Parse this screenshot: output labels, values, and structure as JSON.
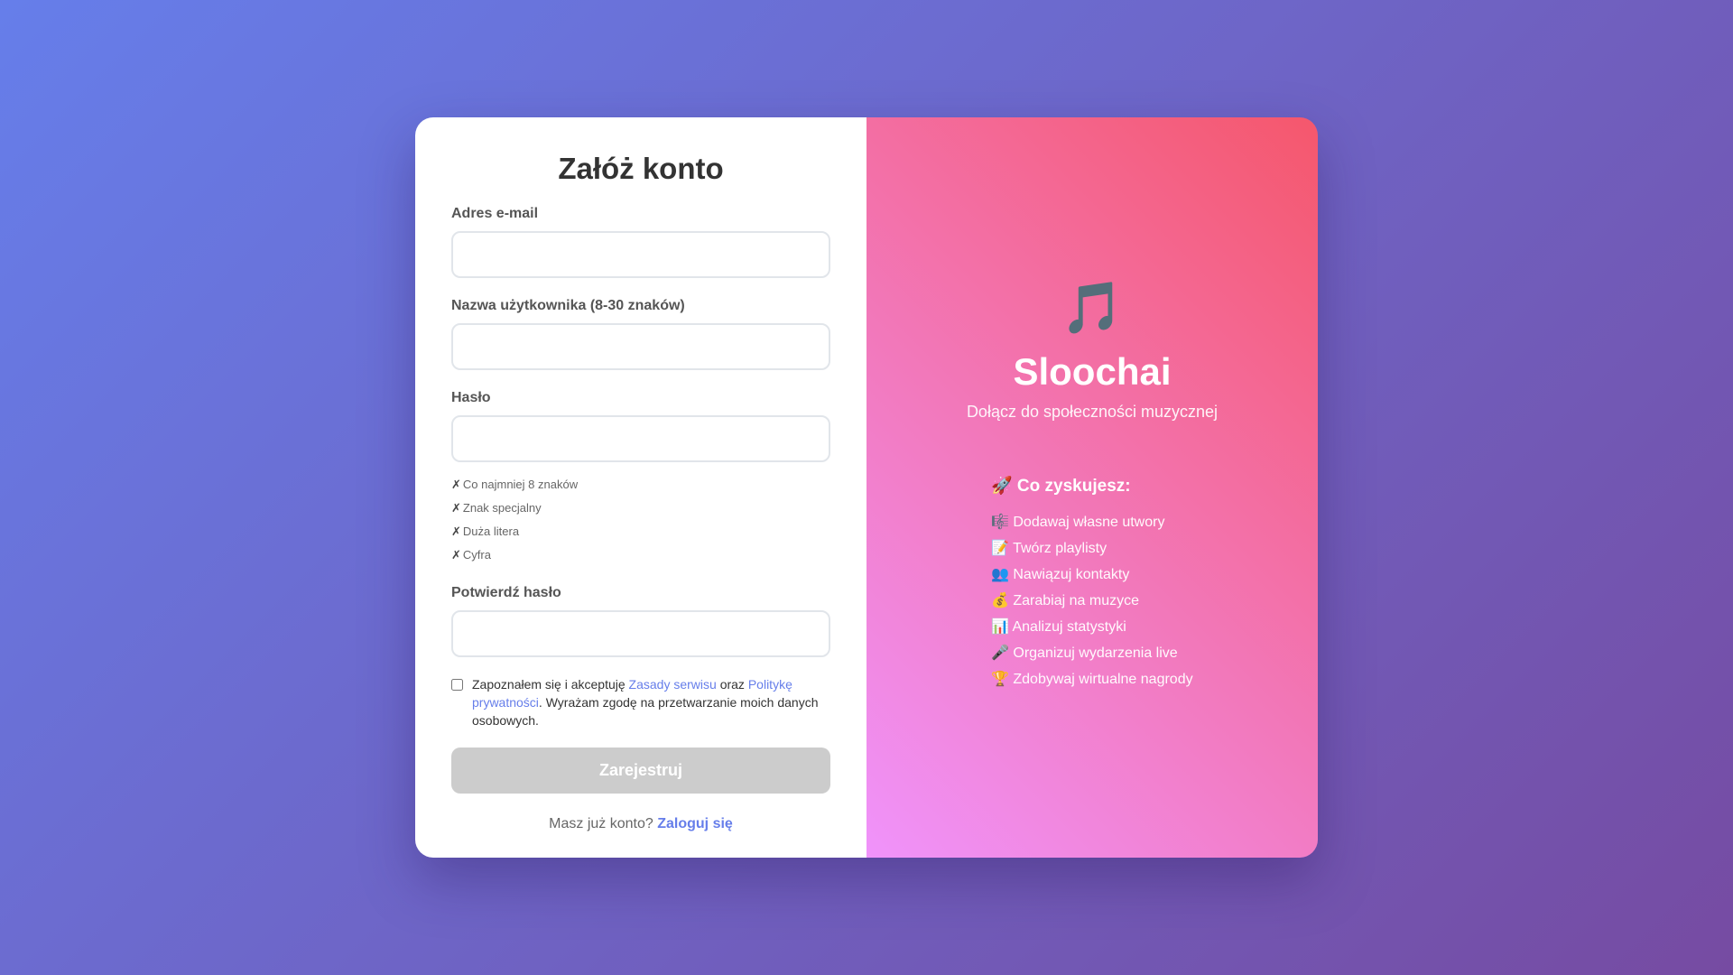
{
  "form": {
    "title": "Załóż konto",
    "email_label": "Adres e-mail",
    "username_label": "Nazwa użytkownika (8-30 znaków)",
    "password_label": "Hasło",
    "password_requirements": [
      {
        "mark": "✗",
        "text": "Co najmniej 8 znaków"
      },
      {
        "mark": "✗",
        "text": "Znak specjalny"
      },
      {
        "mark": "✗",
        "text": "Duża litera"
      },
      {
        "mark": "✗",
        "text": "Cyfra"
      }
    ],
    "confirm_label": "Potwierdź hasło",
    "email_value": "",
    "username_value": "",
    "password_value": "",
    "confirm_value": "",
    "consent_checked": false,
    "consent": {
      "text_before": "Zapoznałem się i akceptuję ",
      "terms_link": "Zasady serwisu",
      "text_between": " oraz ",
      "privacy_link": "Politykę prywatności",
      "text_after": ". Wyrażam zgodę na przetwarzanie moich danych osobowych."
    },
    "submit_label": "Zarejestruj",
    "submit_enabled": false,
    "login_prompt": "Masz już konto?",
    "login_link": "Zaloguj się"
  },
  "promo": {
    "icon": "music-note-icon",
    "icon_glyph": "🎵",
    "brand": "Sloochai",
    "tagline": "Dołącz do społeczności muzycznej",
    "benefits_title": "🚀 Co zyskujesz:",
    "benefits": [
      {
        "icon": "🎼",
        "text": "Dodawaj własne utwory"
      },
      {
        "icon": "📝",
        "text": "Twórz playlisty"
      },
      {
        "icon": "👥",
        "text": "Nawiązuj kontakty"
      },
      {
        "icon": "💰",
        "text": "Zarabiaj na muzyce"
      },
      {
        "icon": "📊",
        "text": "Analizuj statystyki"
      },
      {
        "icon": "🎤",
        "text": "Organizuj wydarzenia live"
      },
      {
        "icon": "🏆",
        "text": "Zdobywaj wirtualne nagrody"
      }
    ]
  },
  "colors": {
    "accent": "#667eea",
    "background_start": "#667eea",
    "background_end": "#764ba2",
    "promo_start": "#f093fb",
    "promo_end": "#f5576c",
    "button_disabled": "#cccccc"
  }
}
